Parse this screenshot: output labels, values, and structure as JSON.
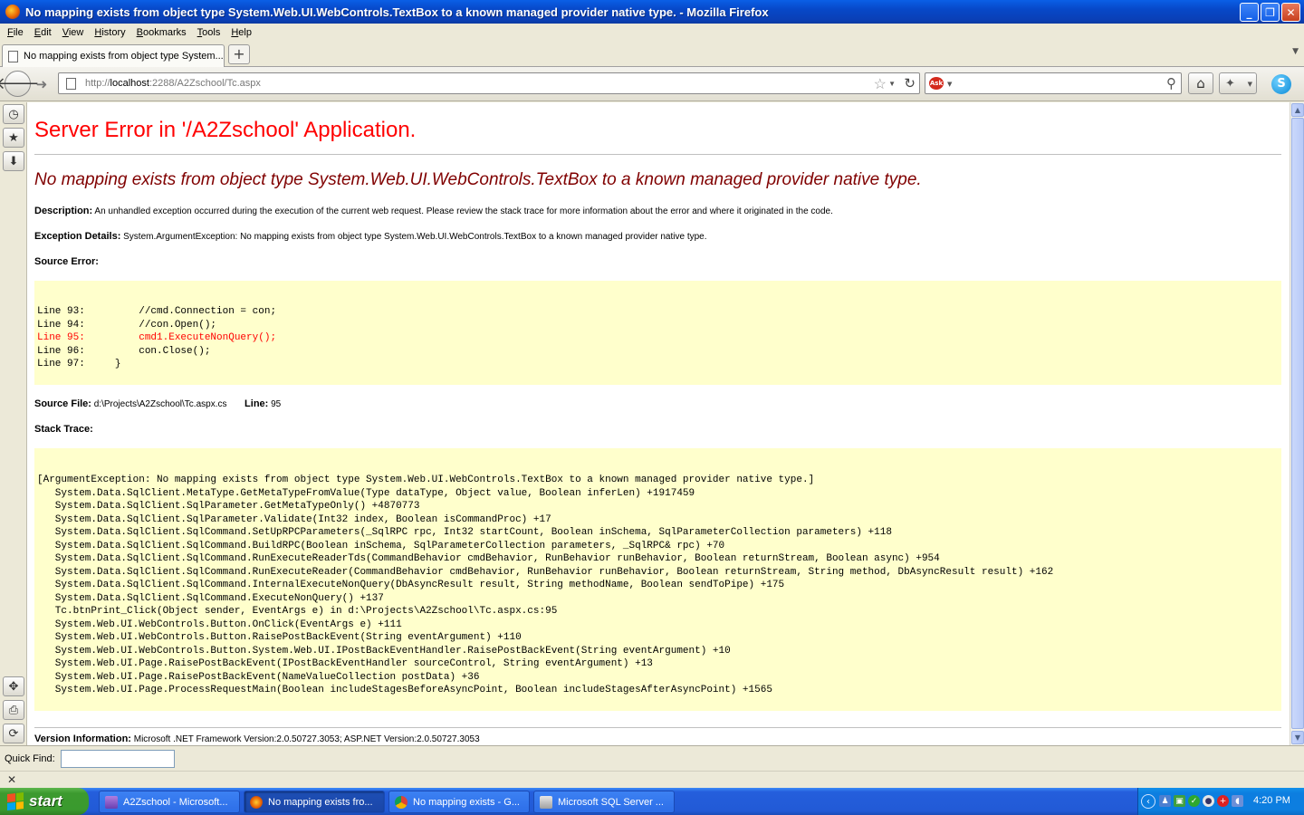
{
  "window": {
    "title": "No mapping exists from object type System.Web.UI.WebControls.TextBox to a known managed provider native type. - Mozilla Firefox",
    "minimize": "_",
    "maximize": "❐",
    "close": "✕"
  },
  "menu": [
    "File",
    "Edit",
    "View",
    "History",
    "Bookmarks",
    "Tools",
    "Help"
  ],
  "tab": {
    "title": "No mapping exists from object type System....",
    "new_tab": "+"
  },
  "urlbar": {
    "scheme": "http://",
    "host": "localhost",
    "path": ":2288/A2Zschool/Tc.aspx"
  },
  "search": {
    "value": "",
    "engine": "Ask"
  },
  "page": {
    "heading": "Server Error in '/A2Zschool' Application.",
    "error_title": "No mapping exists from object type System.Web.UI.WebControls.TextBox to a known managed provider native type.",
    "description_label": "Description:",
    "description_text": " An unhandled exception occurred during the execution of the current web request. Please review the stack trace for more information about the error and where it originated in the code.",
    "exception_label": "Exception Details:",
    "exception_text": " System.ArgumentException: No mapping exists from object type System.Web.UI.WebControls.TextBox to a known managed provider native type.",
    "source_error_label": "Source Error:",
    "source_lines": [
      "Line 93:         //cmd.Connection = con;",
      "Line 94:         //con.Open();",
      "Line 95:         cmd1.ExecuteNonQuery();",
      "Line 96:         con.Close();",
      "Line 97:     }"
    ],
    "highlight_line_index": 2,
    "source_file_label": "Source File:",
    "source_file_value": " d:\\Projects\\A2Zschool\\Tc.aspx.cs",
    "line_label": "Line:",
    "line_value": " 95",
    "stack_trace_label": "Stack Trace:",
    "stack_trace": [
      "[ArgumentException: No mapping exists from object type System.Web.UI.WebControls.TextBox to a known managed provider native type.]",
      "   System.Data.SqlClient.MetaType.GetMetaTypeFromValue(Type dataType, Object value, Boolean inferLen) +1917459",
      "   System.Data.SqlClient.SqlParameter.GetMetaTypeOnly() +4870773",
      "   System.Data.SqlClient.SqlParameter.Validate(Int32 index, Boolean isCommandProc) +17",
      "   System.Data.SqlClient.SqlCommand.SetUpRPCParameters(_SqlRPC rpc, Int32 startCount, Boolean inSchema, SqlParameterCollection parameters) +118",
      "   System.Data.SqlClient.SqlCommand.BuildRPC(Boolean inSchema, SqlParameterCollection parameters, _SqlRPC& rpc) +70",
      "   System.Data.SqlClient.SqlCommand.RunExecuteReaderTds(CommandBehavior cmdBehavior, RunBehavior runBehavior, Boolean returnStream, Boolean async) +954",
      "   System.Data.SqlClient.SqlCommand.RunExecuteReader(CommandBehavior cmdBehavior, RunBehavior runBehavior, Boolean returnStream, String method, DbAsyncResult result) +162",
      "   System.Data.SqlClient.SqlCommand.InternalExecuteNonQuery(DbAsyncResult result, String methodName, Boolean sendToPipe) +175",
      "   System.Data.SqlClient.SqlCommand.ExecuteNonQuery() +137",
      "   Tc.btnPrint_Click(Object sender, EventArgs e) in d:\\Projects\\A2Zschool\\Tc.aspx.cs:95",
      "   System.Web.UI.WebControls.Button.OnClick(EventArgs e) +111",
      "   System.Web.UI.WebControls.Button.RaisePostBackEvent(String eventArgument) +110",
      "   System.Web.UI.WebControls.Button.System.Web.UI.IPostBackEventHandler.RaisePostBackEvent(String eventArgument) +10",
      "   System.Web.UI.Page.RaisePostBackEvent(IPostBackEventHandler sourceControl, String eventArgument) +13",
      "   System.Web.UI.Page.RaisePostBackEvent(NameValueCollection postData) +36",
      "   System.Web.UI.Page.ProcessRequestMain(Boolean includeStagesBeforeAsyncPoint, Boolean includeStagesAfterAsyncPoint) +1565"
    ],
    "version_label": "Version Information:",
    "version_text": " Microsoft .NET Framework Version:2.0.50727.3053; ASP.NET Version:2.0.50727.3053"
  },
  "findbar": {
    "label": "Quick Find:",
    "value": ""
  },
  "taskbar": {
    "start": "start",
    "tasks": [
      {
        "label": "A2Zschool - Microsoft...",
        "active": false
      },
      {
        "label": "No mapping exists fro...",
        "active": true
      },
      {
        "label": "No mapping exists - G...",
        "active": false
      },
      {
        "label": "Microsoft SQL Server ...",
        "active": false
      }
    ],
    "clock": "4:20 PM"
  },
  "colors": {
    "heading_red": "#ff0000",
    "error_title_maroon": "#800000",
    "code_background": "#ffffcc",
    "titlebar_blue": "#0a5fe6",
    "taskbar_blue": "#245edc",
    "start_green": "#3c9a2f"
  },
  "icons": {
    "back": "back-arrow-icon",
    "forward": "forward-arrow-icon",
    "bookmark_star": "star-icon",
    "reload": "reload-icon",
    "search": "magnifier-icon",
    "home": "home-icon"
  }
}
